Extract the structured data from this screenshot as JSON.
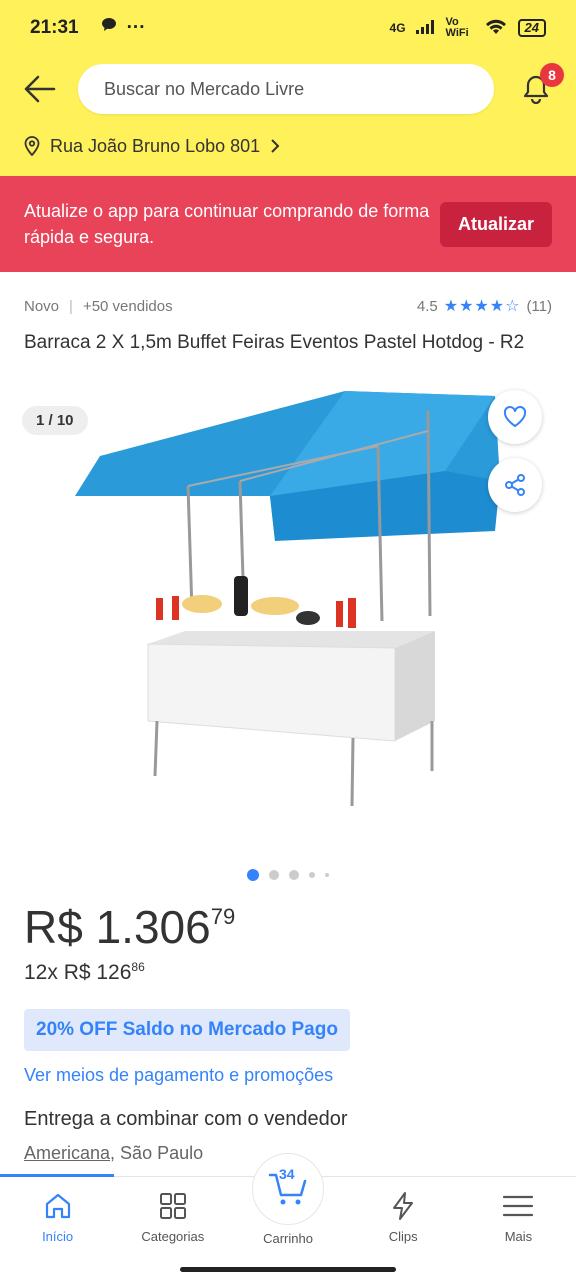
{
  "status_bar": {
    "time": "21:31",
    "network": "4G",
    "volte": "Vo WiFi",
    "battery": "24"
  },
  "header": {
    "search_placeholder": "Buscar no Mercado Livre",
    "notifications_count": "8",
    "address": "Rua João Bruno Lobo 801"
  },
  "banner": {
    "message": "Atualize o app para continuar comprando de forma rápida e segura.",
    "button_label": "Atualizar"
  },
  "product": {
    "condition": "Novo",
    "sold": "+50 vendidos",
    "rating": "4.5",
    "stars_value": 4.5,
    "reviews": "(11)",
    "title": "Barraca 2 X 1,5m Buffet Feiras Eventos Pastel Hotdog - R2",
    "image_counter": "1 / 10",
    "price_int": "R$ 1.306",
    "price_cents": "79",
    "installments_text": "12x R$ 126",
    "installments_cents": "86",
    "promo": "20% OFF Saldo no Mercado Pago",
    "payment_link": "Ver meios de pagamento e promoções",
    "delivery": "Entrega a combinar com o vendedor",
    "location_city": "Americana",
    "location_state": ", São Paulo"
  },
  "nav": {
    "items": [
      {
        "label": "Início",
        "icon": "home-icon"
      },
      {
        "label": "Categorias",
        "icon": "categories-icon"
      },
      {
        "label": "Carrinho",
        "icon": "cart-icon",
        "count": "34"
      },
      {
        "label": "Clips",
        "icon": "clips-icon"
      },
      {
        "label": "Mais",
        "icon": "menu-icon"
      }
    ]
  },
  "colors": {
    "header_bg": "#fff159",
    "banner_bg": "#e9435a",
    "accent": "#3483fa"
  }
}
